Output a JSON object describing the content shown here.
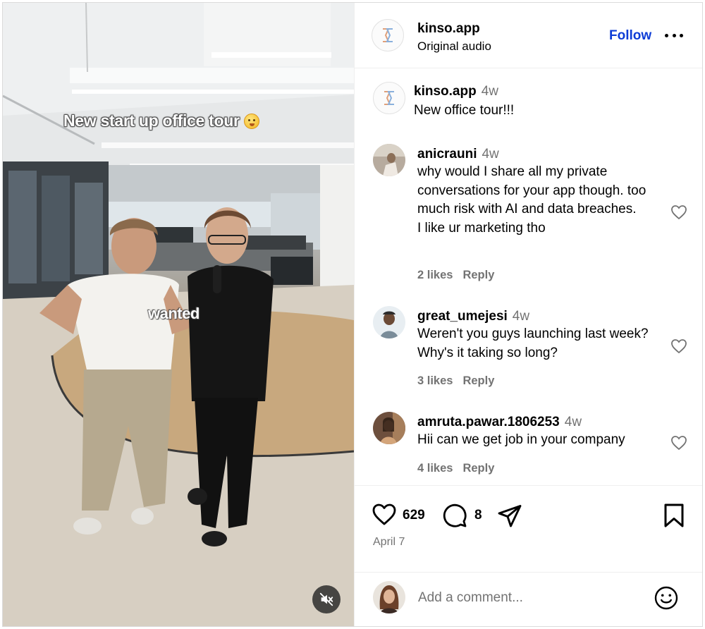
{
  "post": {
    "author": "kinso.app",
    "audio": "Original audio",
    "follow_label": "Follow",
    "overlay_caption": "New start up office tour",
    "overlay_word": "wanted"
  },
  "caption": {
    "author": "kinso.app",
    "time": "4w",
    "text": "New office tour!!!"
  },
  "comments": [
    {
      "author": "anicrauni",
      "time": "4w",
      "text": "why would I share all my private conversations for your app though. too much risk with AI and data breaches.",
      "text2": "I like ur marketing tho",
      "likes": "2 likes",
      "reply": "Reply"
    },
    {
      "author": "great_umejesi",
      "time": "4w",
      "text": "Weren't you guys launching last week? Why's it taking so long?",
      "likes": "3 likes",
      "reply": "Reply"
    },
    {
      "author": "amruta.pawar.1806253",
      "time": "4w",
      "text": "Hii can we get job in your company",
      "likes": "4 likes",
      "reply": "Reply"
    }
  ],
  "actions": {
    "like_count": "629",
    "comment_count": "8",
    "date": "April 7"
  },
  "add_comment": {
    "placeholder": "Add a comment..."
  },
  "icons": [
    "heart-icon",
    "comment-icon",
    "share-icon",
    "bookmark-icon",
    "more-icon",
    "mute-icon",
    "emoji-icon"
  ],
  "colors": {
    "accent": "#0d3cd6",
    "secondary_text": "#737373",
    "divider": "#efefef"
  }
}
